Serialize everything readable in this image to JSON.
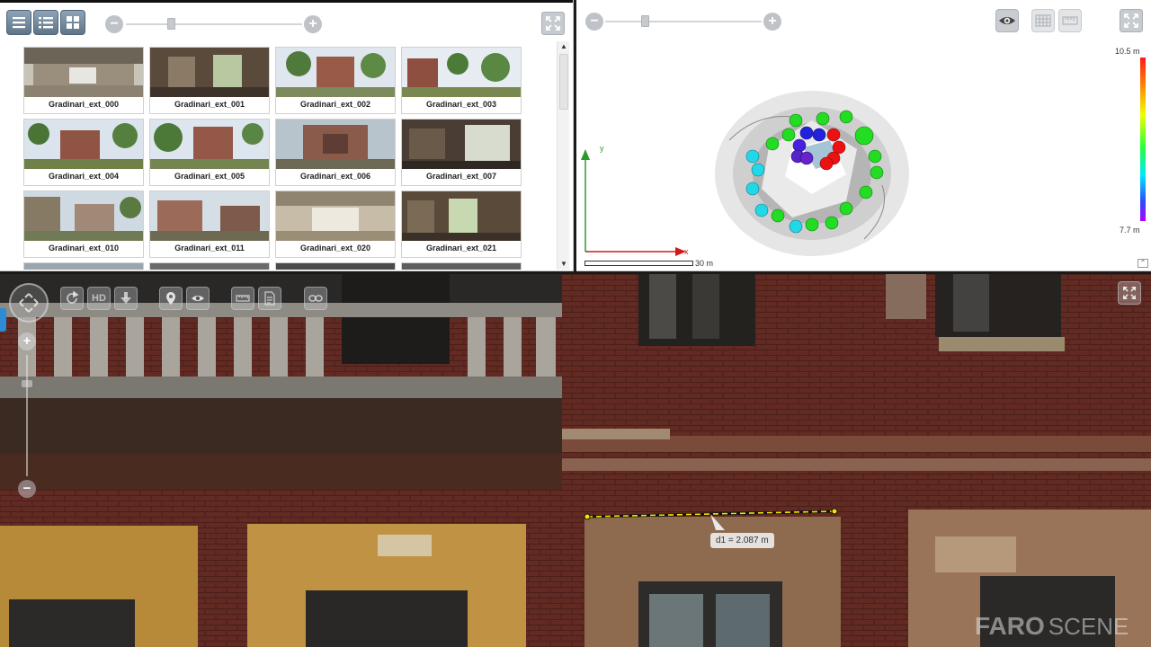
{
  "browser": {
    "thumbnails": [
      {
        "label": "Gradinari_ext_000"
      },
      {
        "label": "Gradinari_ext_001"
      },
      {
        "label": "Gradinari_ext_002"
      },
      {
        "label": "Gradinari_ext_003"
      },
      {
        "label": "Gradinari_ext_004"
      },
      {
        "label": "Gradinari_ext_005"
      },
      {
        "label": "Gradinari_ext_006"
      },
      {
        "label": "Gradinari_ext_007"
      },
      {
        "label": "Gradinari_ext_010"
      },
      {
        "label": "Gradinari_ext_011"
      },
      {
        "label": "Gradinari_ext_020"
      },
      {
        "label": "Gradinari_ext_021"
      }
    ]
  },
  "overview": {
    "colorbar_max": "10.5 m",
    "colorbar_min": "7.7 m",
    "axis_y": "y",
    "axis_x": "x",
    "scale_label": "30 m"
  },
  "viewer": {
    "hd_label": "HD",
    "measurement_label": "d1 = 2.087 m",
    "brand_faro": "FARO",
    "brand_scene": "SCENE"
  },
  "colors": {
    "toolbar_button": "#6b8195",
    "scan_green": "#22dd22",
    "scan_cyan": "#22d8e8",
    "scan_blue": "#2222dd",
    "scan_red": "#ee1111",
    "measure_line": "#f2e600"
  }
}
